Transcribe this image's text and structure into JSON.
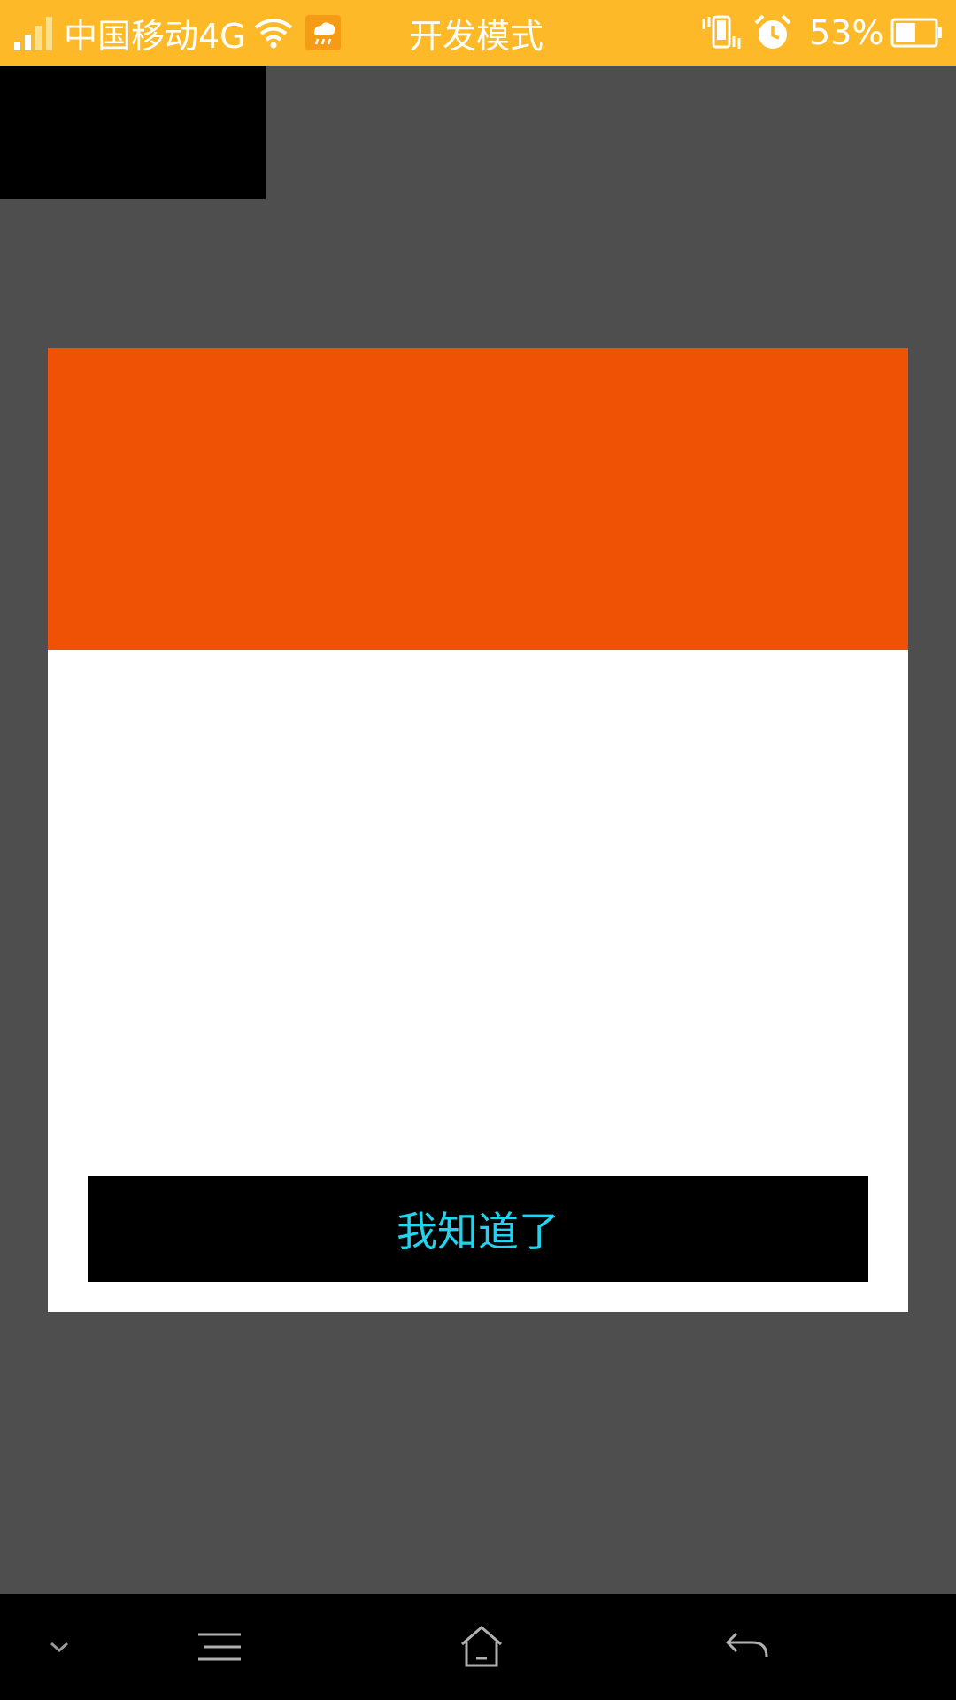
{
  "status_bar": {
    "carrier": "中国移动4G",
    "mode": "开发模式",
    "battery_percent": "53%",
    "battery_level": 0.53,
    "icons": {
      "signal": "signal-icon",
      "wifi": "wifi-icon",
      "weather": "weather-rain-icon",
      "vibrate": "vibrate-icon",
      "alarm": "alarm-icon",
      "battery": "battery-icon"
    },
    "colors": {
      "background": "#fdb927",
      "text": "#ffffff"
    }
  },
  "dialog": {
    "confirm_label": "我知道了",
    "colors": {
      "header": "#ef5205",
      "body": "#ffffff",
      "button_bg": "#000000",
      "button_text": "#22d3ee"
    }
  },
  "nav_bar": {
    "icons": {
      "collapse": "chevron-down-icon",
      "menu": "menu-icon",
      "home": "home-icon",
      "back": "back-icon"
    }
  },
  "colors": {
    "scrim": "#4e4e4e"
  }
}
